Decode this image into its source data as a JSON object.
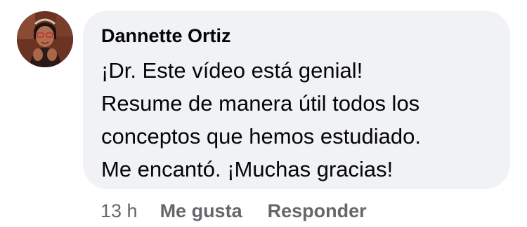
{
  "comment": {
    "author": "Dannette Ortiz",
    "lines": [
      "¡Dr. Este vídeo está genial!",
      "Resume de manera útil todos los",
      "conceptos que hemos estudiado.",
      "Me encantó. ¡Muchas gracias!"
    ],
    "timestamp": "13 h",
    "like_label": "Me gusta",
    "reply_label": "Responder"
  }
}
